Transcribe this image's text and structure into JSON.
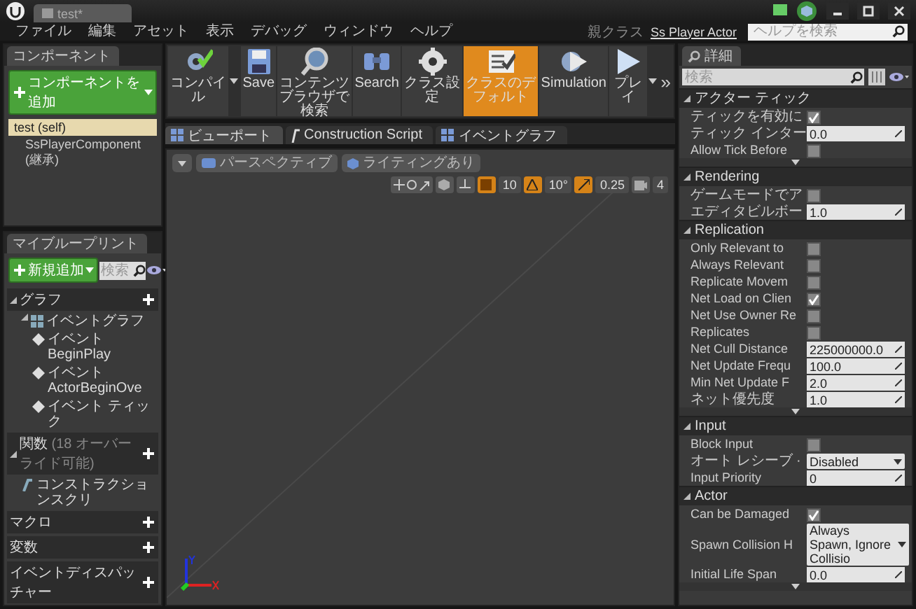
{
  "title_bar": {
    "tab": "test*"
  },
  "menu": [
    "ファイル",
    "編集",
    "アセット",
    "表示",
    "デバッグ",
    "ウィンドウ",
    "ヘルプ"
  ],
  "parent_class": {
    "label": "親クラス",
    "value": "Ss Player Actor"
  },
  "help_search": {
    "placeholder": "ヘルプを検索"
  },
  "components": {
    "tab": "コンポーネント",
    "add_button": "コンポーネントを追加",
    "tree": [
      {
        "label": "test (self)",
        "selected": true,
        "children": [
          {
            "label": "SsPlayerComponent (継承)",
            "selected": false
          }
        ]
      }
    ]
  },
  "my_blueprint": {
    "tab": "マイブループリント",
    "add_button": "新規追加",
    "search": {
      "placeholder": "検索"
    },
    "sections": [
      {
        "label": "グラフ",
        "items": [
          {
            "label": "イベントグラフ",
            "kind": "graph",
            "children": [
              {
                "label": "イベント BeginPlay",
                "kind": "event"
              },
              {
                "label": "イベント ActorBeginOve",
                "kind": "event"
              },
              {
                "label": "イベント ティック",
                "kind": "event"
              }
            ]
          }
        ]
      },
      {
        "label": "関数",
        "note": "(18 オーバーライド可能)",
        "items": [
          {
            "label": "コンストラクションスクリ",
            "kind": "function"
          }
        ]
      },
      {
        "label": "マクロ"
      },
      {
        "label": "変数"
      },
      {
        "label": "イベントディスパッチャー"
      }
    ]
  },
  "toolbar": [
    {
      "kind": "compile",
      "label": "コンパイル",
      "dropdown": true,
      "selected": false
    },
    {
      "kind": "save",
      "label": "Save",
      "dropdown": false,
      "selected": false
    },
    {
      "kind": "browse",
      "label": "コンテンツブラウザで検索",
      "dropdown": false,
      "selected": false
    },
    {
      "kind": "search",
      "label": "Search",
      "dropdown": false,
      "selected": false
    },
    {
      "kind": "settings",
      "label": "クラス設定",
      "dropdown": false,
      "selected": false
    },
    {
      "kind": "defaults",
      "label": "クラスのデフォルト",
      "dropdown": false,
      "selected": true
    },
    {
      "kind": "simulation",
      "label": "Simulation",
      "dropdown": false,
      "selected": false
    },
    {
      "kind": "play",
      "label": "プレイ",
      "dropdown": true,
      "selected": false
    }
  ],
  "toolbar_overflow": "»",
  "viewport_tabs": [
    {
      "label": "ビューポート",
      "kind": "viewport",
      "selected": true
    },
    {
      "label": "Construction Script",
      "kind": "function",
      "selected": false
    },
    {
      "label": "イベントグラフ",
      "kind": "graph",
      "selected": false
    }
  ],
  "viewport_toolbar": {
    "view": "パースペクティブ",
    "lighting": "ライティングあり",
    "grid_snap": {
      "value": "10",
      "on": true
    },
    "rotation_snap": {
      "value": "10°",
      "on": true
    },
    "scale_snap": {
      "value": "0.25",
      "on": true
    },
    "camera_speed": "4"
  },
  "details": {
    "tab": "詳細",
    "search": {
      "placeholder": "検索"
    },
    "sections": [
      {
        "title": "アクター ティック",
        "advanced": true,
        "rows": [
          {
            "label": "ティックを有効に",
            "kind": "checkbox",
            "checked": true
          },
          {
            "label": "ティック インター",
            "kind": "number",
            "value": "0.0"
          },
          {
            "label": "Allow Tick Before",
            "kind": "checkbox",
            "checked": false
          }
        ]
      },
      {
        "title": "Rendering",
        "advanced": false,
        "rows": [
          {
            "label": "ゲームモードでア",
            "kind": "checkbox",
            "checked": false
          },
          {
            "label": "エディタビルボー",
            "kind": "number",
            "value": "1.0"
          }
        ]
      },
      {
        "title": "Replication",
        "advanced": true,
        "rows": [
          {
            "label": "Only Relevant to",
            "kind": "checkbox",
            "checked": false
          },
          {
            "label": "Always Relevant",
            "kind": "checkbox",
            "checked": false
          },
          {
            "label": "Replicate Movem",
            "kind": "checkbox",
            "checked": false
          },
          {
            "label": "Net Load on Clien",
            "kind": "checkbox",
            "checked": true
          },
          {
            "label": "Net Use Owner Re",
            "kind": "checkbox",
            "checked": false
          },
          {
            "label": "Replicates",
            "kind": "checkbox",
            "checked": false
          },
          {
            "label": "Net Cull Distance",
            "kind": "number",
            "value": "225000000.0"
          },
          {
            "label": "Net Update Frequ",
            "kind": "number",
            "value": "100.0"
          },
          {
            "label": "Min Net Update F",
            "kind": "number",
            "value": "2.0"
          },
          {
            "label": "ネット優先度",
            "kind": "number",
            "value": "1.0"
          }
        ]
      },
      {
        "title": "Input",
        "advanced": false,
        "rows": [
          {
            "label": "Block Input",
            "kind": "checkbox",
            "checked": false
          },
          {
            "label": "オート レシーブ ·",
            "kind": "dropdown",
            "value": "Disabled"
          },
          {
            "label": "Input Priority",
            "kind": "number",
            "value": "0"
          }
        ]
      },
      {
        "title": "Actor",
        "advanced": true,
        "rows": [
          {
            "label": "Can be Damaged",
            "kind": "checkbox",
            "checked": true
          },
          {
            "label": "Spawn Collision H",
            "kind": "dropdown",
            "value": "Always Spawn, Ignore Collisio"
          },
          {
            "label": "Initial Life Span",
            "kind": "number",
            "value": "0.0"
          }
        ]
      }
    ]
  }
}
